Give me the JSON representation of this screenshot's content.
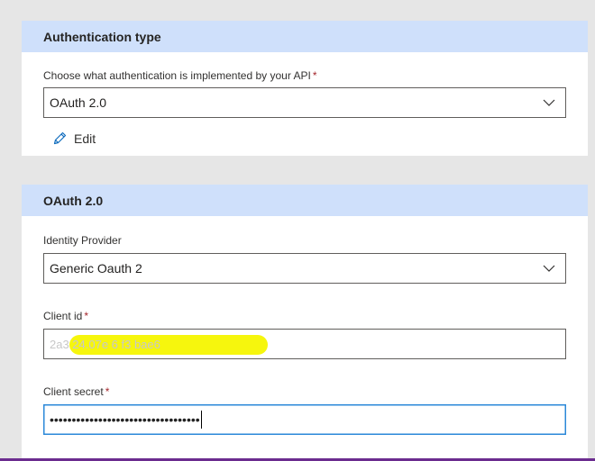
{
  "auth_section": {
    "title": "Authentication type",
    "label": "Choose what authentication is implemented by your API",
    "required_mark": "*",
    "selected": "OAuth 2.0",
    "edit_label": "Edit"
  },
  "oauth_section": {
    "title": "OAuth 2.0",
    "identity_provider": {
      "label": "Identity Provider",
      "selected": "Generic Oauth 2"
    },
    "client_id": {
      "label": "Client id",
      "required_mark": "*",
      "value": "2a3  24.07e   6 f3  bae6"
    },
    "client_secret": {
      "label": "Client secret",
      "required_mark": "*",
      "value": "••••••••••••••••••••••••••••••••••"
    }
  },
  "colors": {
    "header_bg": "#cfe0fb",
    "required": "#a4262c",
    "focus_border": "#2b88d8",
    "redaction_highlight": "#f5f500"
  },
  "icons": {
    "dropdown": "chevron-down-icon",
    "edit": "pencil-icon"
  }
}
